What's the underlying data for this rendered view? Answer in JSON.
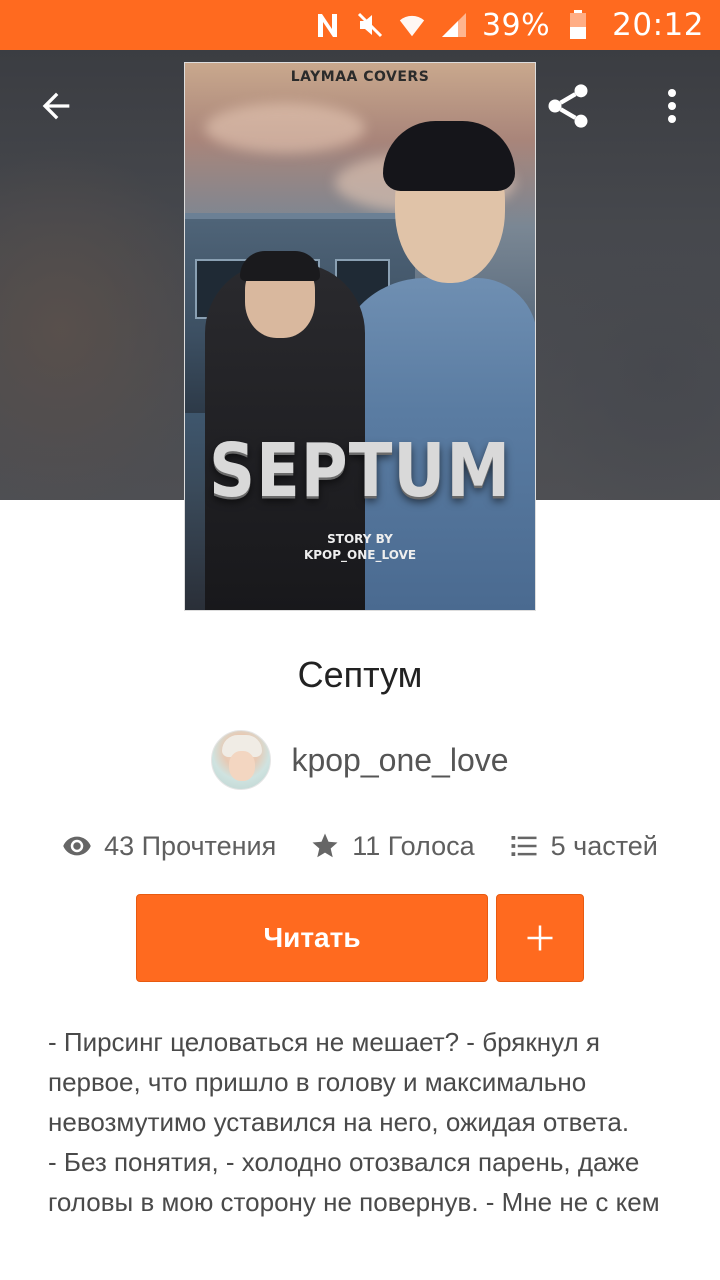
{
  "status_bar": {
    "battery": "39%",
    "time": "20:12",
    "icons": [
      "nfc-icon",
      "mute-icon",
      "wifi-icon",
      "signal-icon",
      "battery-icon"
    ]
  },
  "colors": {
    "accent": "#ff6a1f",
    "header_bg": "#46484d"
  },
  "header": {
    "back_icon": "arrow-back-icon",
    "share_icon": "share-icon",
    "more_icon": "more-vert-icon"
  },
  "cover": {
    "top_text": "LAYMAA COVERS",
    "title": "SEPTUM",
    "subtitle_line1": "STORY BY",
    "subtitle_line2": "KPOP_ONE_LOVE"
  },
  "story": {
    "title": "Септум",
    "author": "kpop_one_love"
  },
  "stats": {
    "reads": "43 Прочтения",
    "votes": "11 Голоса",
    "parts": "5 частей"
  },
  "actions": {
    "read_label": "Читать",
    "add_label": "+"
  },
  "description": {
    "paragraphs": [
      "- Пирсинг целоваться не мешает? - брякнул я первое, что пришло в голову и максимально невозмутимо уставился на него, ожидая ответа.",
      "- Без понятия, - холодно отозвался парень, даже головы в мою сторону не повернув. - Мне не с кем"
    ]
  }
}
